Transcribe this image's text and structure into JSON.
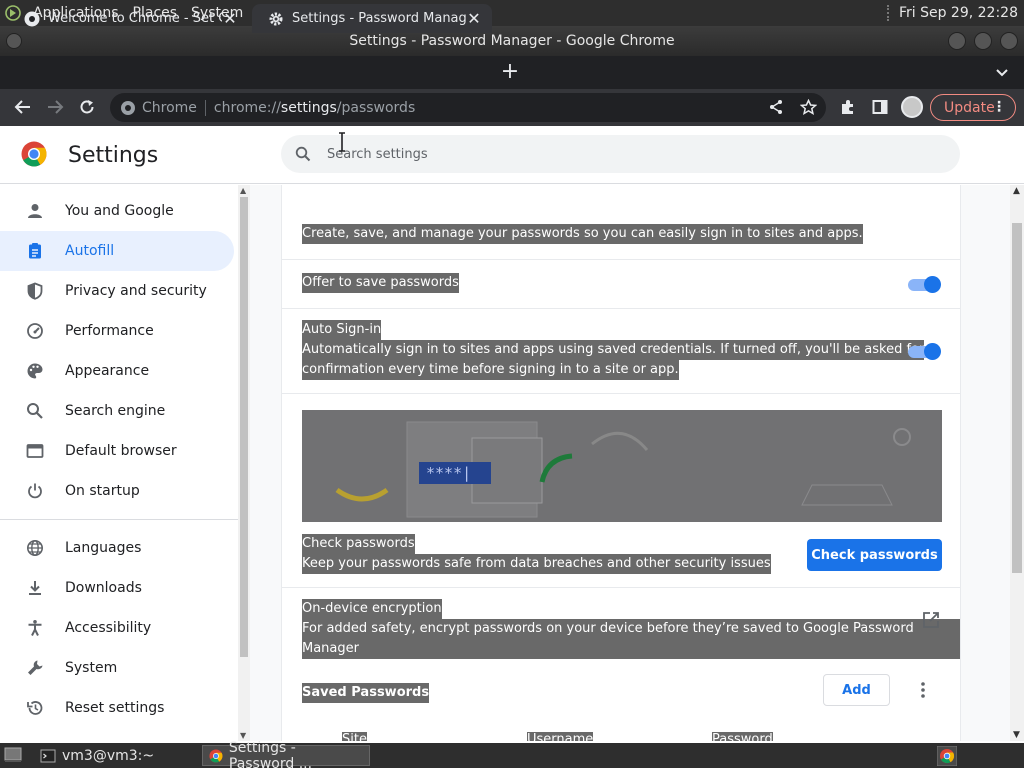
{
  "top_panel": {
    "menus": [
      "Applications",
      "Places",
      "System"
    ],
    "clock": "Fri Sep 29, 22:28"
  },
  "window": {
    "title": "Settings - Password Manager - Google Chrome"
  },
  "tabs": [
    {
      "label": "Welcome to Chrome - Set Chr",
      "close": "✕",
      "icon": "chrome-icon"
    },
    {
      "label": "Settings - Password Manager",
      "close": "✕",
      "icon": "gear-icon"
    }
  ],
  "new_tab": "+",
  "omnibox": {
    "chip": "Chrome",
    "url_scheme": "chrome://",
    "url_host": "settings",
    "url_path": "/passwords"
  },
  "update_label": "Update",
  "settings": {
    "title": "Settings",
    "search_placeholder": "Search settings"
  },
  "sidebar": {
    "items": [
      {
        "label": "You and Google",
        "icon": "person-icon"
      },
      {
        "label": "Autofill",
        "icon": "clipboard-icon",
        "selected": true
      },
      {
        "label": "Privacy and security",
        "icon": "shield-icon"
      },
      {
        "label": "Performance",
        "icon": "speedometer-icon"
      },
      {
        "label": "Appearance",
        "icon": "palette-icon"
      },
      {
        "label": "Search engine",
        "icon": "search-icon"
      },
      {
        "label": "Default browser",
        "icon": "browser-icon"
      },
      {
        "label": "On startup",
        "icon": "power-icon"
      },
      {
        "label": "Languages",
        "icon": "globe-icon"
      },
      {
        "label": "Downloads",
        "icon": "download-icon"
      },
      {
        "label": "Accessibility",
        "icon": "accessibility-icon"
      },
      {
        "label": "System",
        "icon": "wrench-icon"
      },
      {
        "label": "Reset settings",
        "icon": "history-icon"
      }
    ]
  },
  "main": {
    "intro": "Create, save, and manage your passwords so you can easily sign in to sites and apps.",
    "offer_save": {
      "label": "Offer to save passwords",
      "enabled": true
    },
    "auto_signin": {
      "label": "Auto Sign-in",
      "desc_line1": "Automatically sign in to sites and apps using saved credentials. If turned off, you'll be asked for",
      "desc_line2": "confirmation every time before signing in to a site or app.",
      "enabled": true
    },
    "banner_mask": "****|",
    "check_passwords": {
      "label": "Check passwords",
      "desc": "Keep your passwords safe from data breaches and other security issues",
      "button": "Check passwords"
    },
    "encryption": {
      "label": "On-device encryption",
      "desc": "For added safety, encrypt passwords on your device before they’re saved to Google Password Manager"
    },
    "saved": {
      "label": "Saved Passwords",
      "add_button": "Add",
      "columns": [
        "Site",
        "Username",
        "Password"
      ]
    }
  },
  "taskbar": {
    "items": [
      {
        "label": "vm3@vm3:~",
        "icon": "terminal-icon"
      },
      {
        "label": "Settings - Password ...",
        "icon": "chrome-icon"
      }
    ]
  },
  "colors": {
    "accent": "#1a73e8",
    "selection": "#696969",
    "update": "#f28b82"
  }
}
